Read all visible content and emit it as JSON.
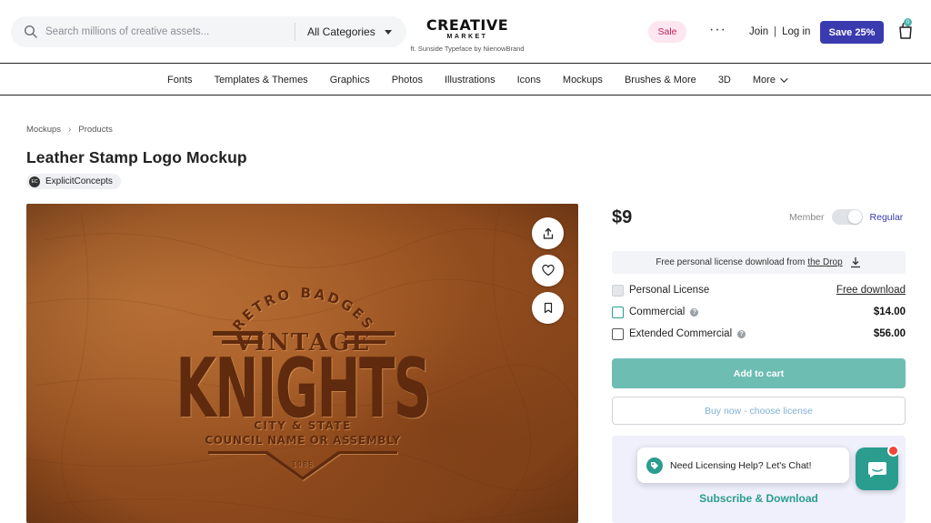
{
  "header": {
    "search_placeholder": "Search millions of creative assets...",
    "category_select": "All Categories",
    "logo_main": "CREATIVE",
    "logo_sub": "MARKET",
    "logo_credit": "ft. Sunside Typeface by NienowBrand",
    "sale_label": "Sale",
    "more_label": "···",
    "join_label": "Join",
    "auth_separator": "|",
    "login_label": "Log in",
    "save_button": "Save 25%",
    "cart_count": "0",
    "accent_color": "#3b3bb0"
  },
  "nav": {
    "items": [
      "Fonts",
      "Templates & Themes",
      "Graphics",
      "Photos",
      "Illustrations",
      "Icons",
      "Mockups",
      "Brushes & More",
      "3D",
      "More"
    ]
  },
  "breadcrumb": [
    "Mockups",
    "Products"
  ],
  "product": {
    "title": "Leather Stamp Logo Mockup",
    "author": "ExplicitConcepts",
    "author_initials": "EC",
    "image": {
      "line1": "RETRO BADGES",
      "line2": "VINTAGE",
      "line3": "KNIGHTS",
      "line4": "CITY & STATE",
      "line5": "COUNCIL NAME OR ASSEMBLY",
      "line6": "1985"
    }
  },
  "purchase": {
    "price": "$9",
    "member_label": "Member",
    "regular_label": "Regular",
    "free_banner_text": "Free personal license download from",
    "free_banner_link": "the Drop",
    "licenses": [
      {
        "name": "Personal License",
        "price": "Free download",
        "info": false
      },
      {
        "name": "Commercial",
        "price": "$14.00",
        "info": true
      },
      {
        "name": "Extended Commercial",
        "price": "$56.00",
        "info": true
      }
    ],
    "add_to_cart": "Add to cart",
    "buy_now": "Buy now - choose license",
    "subscribe": "Subscribe & Download",
    "teal_color": "#2a9d8f"
  },
  "chat": {
    "message": "Need Licensing Help? Let's Chat!"
  }
}
